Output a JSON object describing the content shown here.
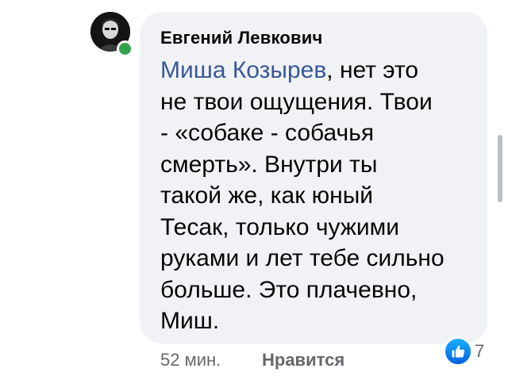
{
  "comment": {
    "author": "Евгений Левкович",
    "mention": "Миша Козырев",
    "lines": [
      ", нет это",
      "не твои ощущения. Твои",
      "- «собаке - собачья",
      "смерть». Внутри ты",
      "такой же, как юный",
      "Тесак, только чужими",
      "руками и лет тебе сильно",
      "больше. Это плачевно,",
      "Миш."
    ],
    "time": "52 мин.",
    "like_label": "Нравится",
    "reaction_count": "7"
  },
  "colors": {
    "bubble": "#f0f2f5",
    "mention": "#385898",
    "online": "#31a24c",
    "like": "#1877f2"
  },
  "icons": {
    "avatar": "user-avatar",
    "reaction": "thumbs-up-icon"
  }
}
